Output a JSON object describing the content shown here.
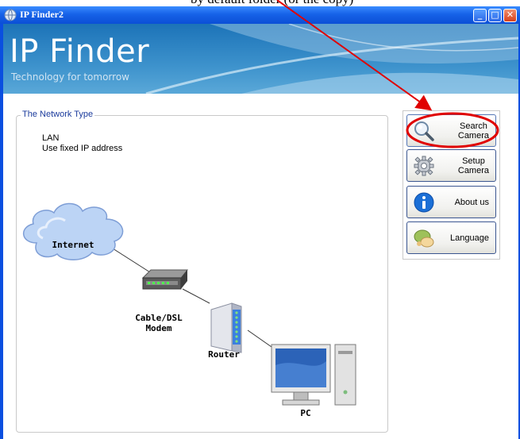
{
  "caption": {
    "text": "by default folder (or the copy)"
  },
  "window": {
    "title": "IP Finder2"
  },
  "window_controls": {
    "minimize": "_",
    "maximize": "□",
    "close": "✕"
  },
  "banner": {
    "title": "IP Finder",
    "tagline": "Technology for tomorrow"
  },
  "network": {
    "legend": "The Network Type",
    "line1": "LAN",
    "line2": "Use fixed IP address"
  },
  "diagram": {
    "internet": "Internet",
    "modem_line1": "Cable/DSL",
    "modem_line2": "Modem",
    "router": "Router",
    "pc": "PC"
  },
  "buttons": {
    "search_line1": "Search",
    "search_line2": "Camera",
    "setup_line1": "Setup",
    "setup_line2": "Camera",
    "about": "About us",
    "language": "Language"
  },
  "icons": {
    "app": "globe-icon",
    "search": "magnifier-icon",
    "setup": "gear-icon",
    "about": "info-icon",
    "language": "language-icon"
  },
  "colors": {
    "titlebar": "#0b4fd6",
    "annotation": "#e00000",
    "accent_blue": "#1b6fd6"
  }
}
